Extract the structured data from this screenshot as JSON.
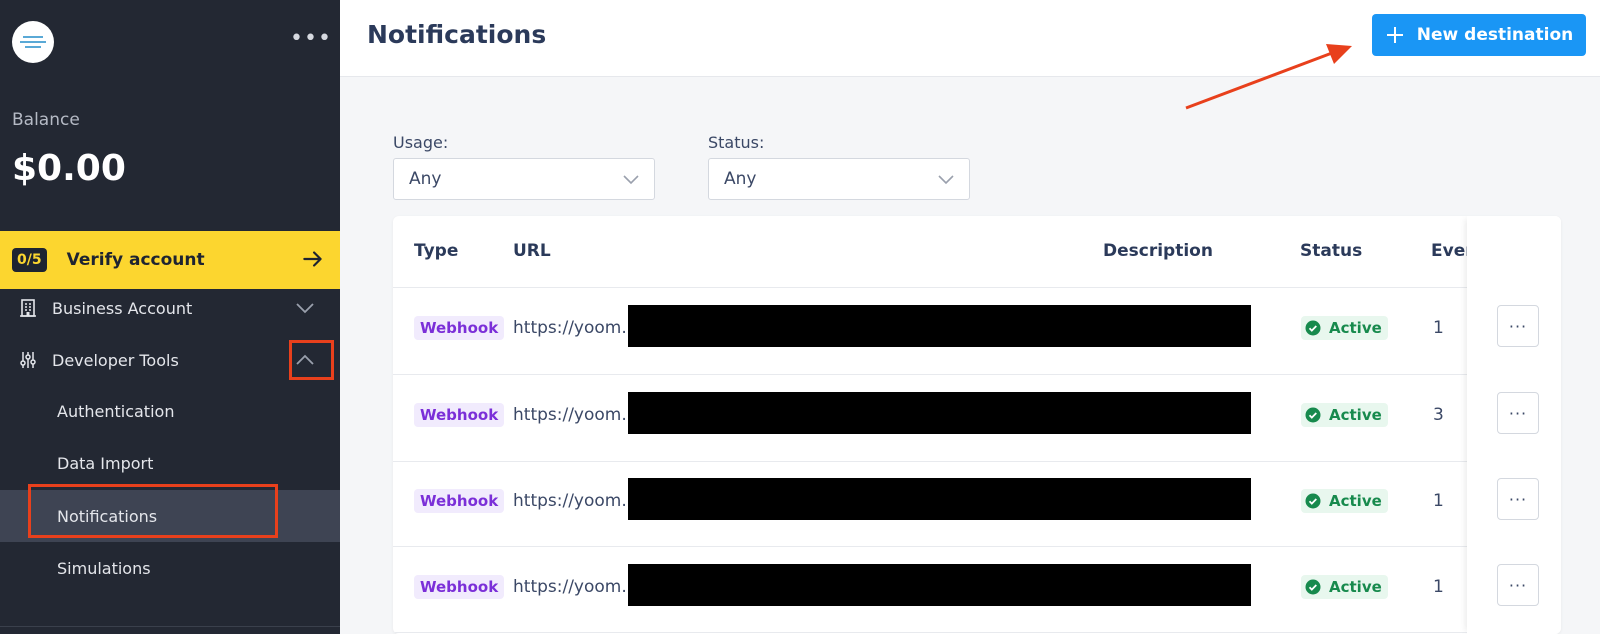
{
  "sidebar": {
    "more_icon": "more-horizontal-icon",
    "balance_label": "Balance",
    "balance_value": "$0.00",
    "verify": {
      "badge": "0/5",
      "label": "Verify account"
    },
    "business_account": {
      "label": "Business Account",
      "icon": "building-icon"
    },
    "developer_tools": {
      "label": "Developer Tools",
      "icon": "sliders-icon"
    },
    "sub_items": [
      {
        "label": "Authentication"
      },
      {
        "label": "Data Import"
      },
      {
        "label": "Notifications"
      },
      {
        "label": "Simulations"
      }
    ]
  },
  "header": {
    "title": "Notifications",
    "new_button": "New destination"
  },
  "filters": {
    "usage": {
      "label": "Usage:",
      "value": "Any"
    },
    "status": {
      "label": "Status:",
      "value": "Any"
    }
  },
  "table": {
    "columns": [
      "Type",
      "URL",
      "Description",
      "Status",
      "Even"
    ],
    "rows": [
      {
        "type": "Webhook",
        "url": "https://yoom.",
        "status": "Active",
        "events": "1"
      },
      {
        "type": "Webhook",
        "url": "https://yoom.",
        "status": "Active",
        "events": "3"
      },
      {
        "type": "Webhook",
        "url": "https://yoom.",
        "status": "Active",
        "events": "1"
      },
      {
        "type": "Webhook",
        "url": "https://yoom.",
        "status": "Active",
        "events": "1"
      }
    ]
  },
  "colors": {
    "sidebar_bg": "#232833",
    "verify_bg": "#fcd62f",
    "primary": "#1a96f5",
    "annotation": "#e8401c",
    "webhook_text": "#7b2fd8",
    "active_text": "#178a4d"
  }
}
